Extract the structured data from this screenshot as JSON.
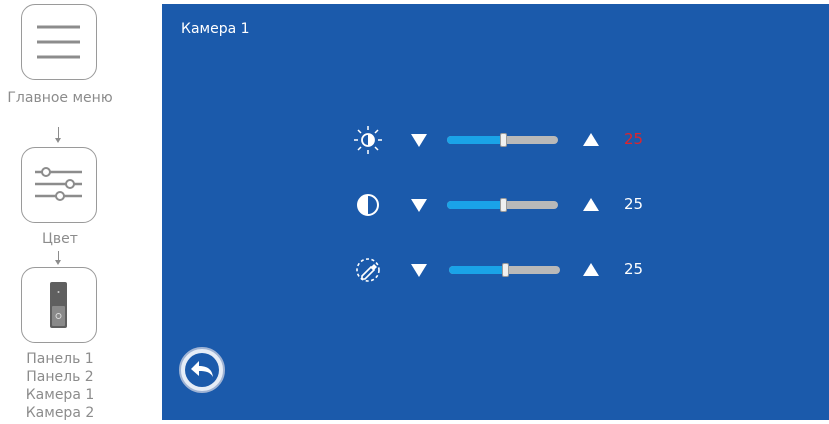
{
  "sidebar": {
    "main_menu_label": "Главное меню",
    "color_label": "Цвет",
    "sources": [
      "Панель 1",
      "Панель 2",
      "Камера 1",
      "Камера 2"
    ]
  },
  "screen": {
    "title": "Камера 1",
    "rows": [
      {
        "name": "brightness",
        "icon": "brightness-icon",
        "value": "25",
        "value_color": "#e0242b",
        "level": 0.5
      },
      {
        "name": "contrast",
        "icon": "contrast-icon",
        "value": "25",
        "value_color": "#ffffff",
        "level": 0.5
      },
      {
        "name": "saturation",
        "icon": "color-dropper-icon",
        "value": "25",
        "value_color": "#ffffff",
        "level": 0.5
      }
    ],
    "back_icon": "back-arrow-icon"
  },
  "colors": {
    "screen_bg": "#1b5aab",
    "slider_fill": "#1aa3e8",
    "slider_track": "#b9b9b9",
    "selected_value": "#e0242b"
  }
}
